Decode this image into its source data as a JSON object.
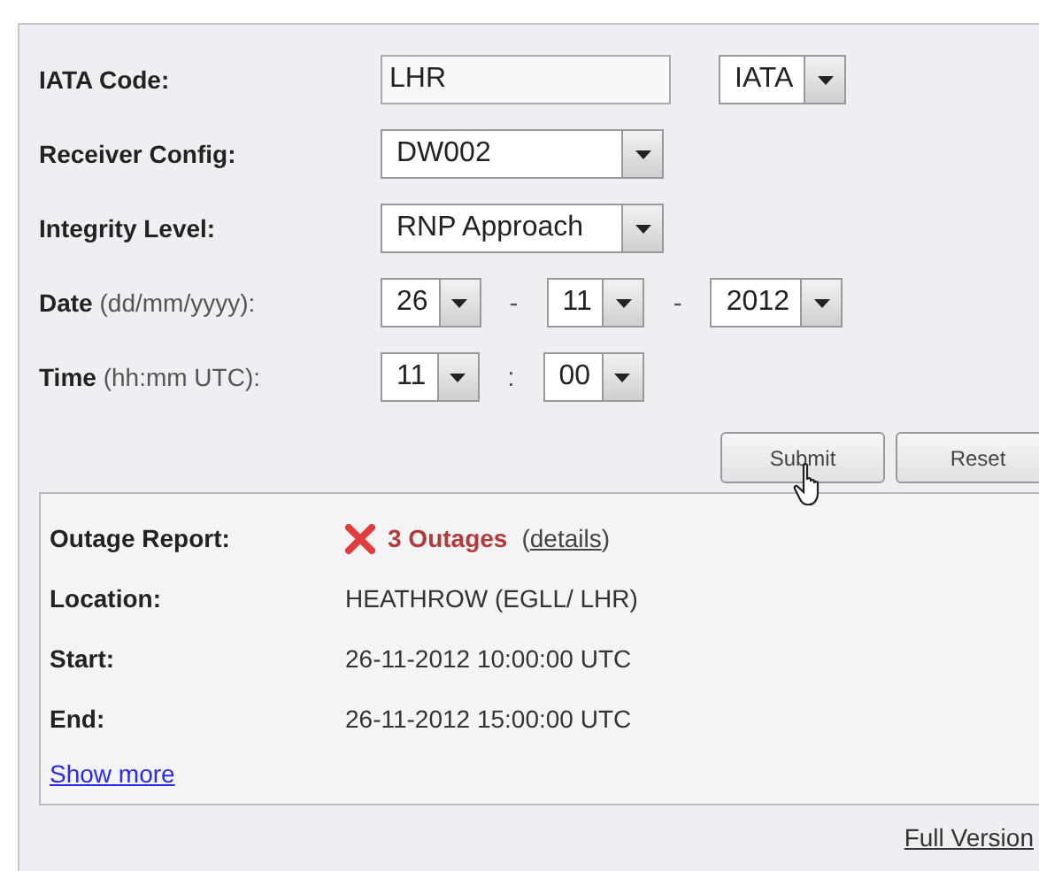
{
  "form": {
    "rows": [
      {
        "kind": "code",
        "label": "IATA Code:",
        "value": "LHR",
        "select": "IATA"
      },
      {
        "kind": "select",
        "label": "Receiver Config:",
        "value": "DW002"
      },
      {
        "kind": "select",
        "label": "Integrity Level:",
        "value": "RNP Approach"
      },
      {
        "kind": "parts",
        "label": "Date",
        "hint": "(dd/mm/yyyy):",
        "items": [
          {
            "kind": "select",
            "text": "26"
          },
          {
            "kind": "sep",
            "text": "-"
          },
          {
            "kind": "select",
            "text": "11"
          },
          {
            "kind": "sep",
            "text": "-"
          },
          {
            "kind": "select",
            "text": "2012"
          }
        ]
      },
      {
        "kind": "parts",
        "label": "Time",
        "hint": "(hh:mm UTC):",
        "items": [
          {
            "kind": "select",
            "text": "11"
          },
          {
            "kind": "sep",
            "text": ":"
          },
          {
            "kind": "select",
            "text": "00"
          }
        ]
      }
    ]
  },
  "buttons": [
    {
      "label": "Submit",
      "hovered": true
    },
    {
      "label": "Reset",
      "hovered": false
    }
  ],
  "report": {
    "rows": [
      {
        "kind": "status",
        "label": "Outage Report:",
        "value": "3 Outages",
        "link_before": "(",
        "link": "details",
        "link_after": ")"
      },
      {
        "kind": "text",
        "label": "Location:",
        "value": "HEATHROW (EGLL/ LHR)"
      },
      {
        "kind": "text",
        "label": "Start:",
        "value": "26-11-2012 10:00:00 UTC"
      },
      {
        "kind": "text",
        "label": "End:",
        "value": "26-11-2012 15:00:00 UTC"
      }
    ],
    "more_link": "Show more"
  },
  "footer_link": "Full Version"
}
